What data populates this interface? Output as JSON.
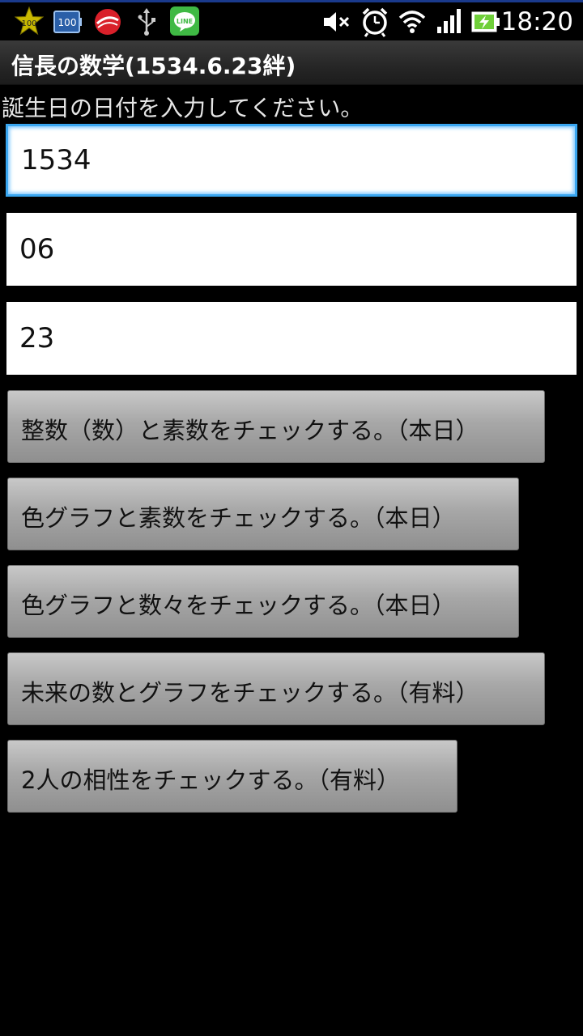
{
  "status_bar": {
    "time": "18:20",
    "badge_100_a": "100",
    "badge_100_b": "100",
    "line_label": "LINE",
    "icons": [
      "star-badge-icon",
      "battery-saver-icon",
      "trend-micro-icon",
      "usb-icon",
      "line-app-icon",
      "mute-icon",
      "alarm-icon",
      "wifi-icon",
      "signal-icon",
      "battery-icon"
    ]
  },
  "app": {
    "title": "信長の数学(1534.6.23絆)"
  },
  "form": {
    "prompt": "誕生日の日付を入力してください。",
    "year_value": "1534",
    "month_value": "06",
    "day_value": "23"
  },
  "buttons": {
    "b1": "整数（数）と素数をチェックする。（本日）",
    "b2": "色グラフと素数をチェックする。（本日）",
    "b3": "色グラフと数々をチェックする。（本日）",
    "b4": "未来の数とグラフをチェックする。（有料）",
    "b5": "2人の相性をチェックする。（有料）"
  },
  "colors": {
    "focus_border": "#39a6f0",
    "status_top_line": "#1a3a8c",
    "background": "#000000"
  }
}
